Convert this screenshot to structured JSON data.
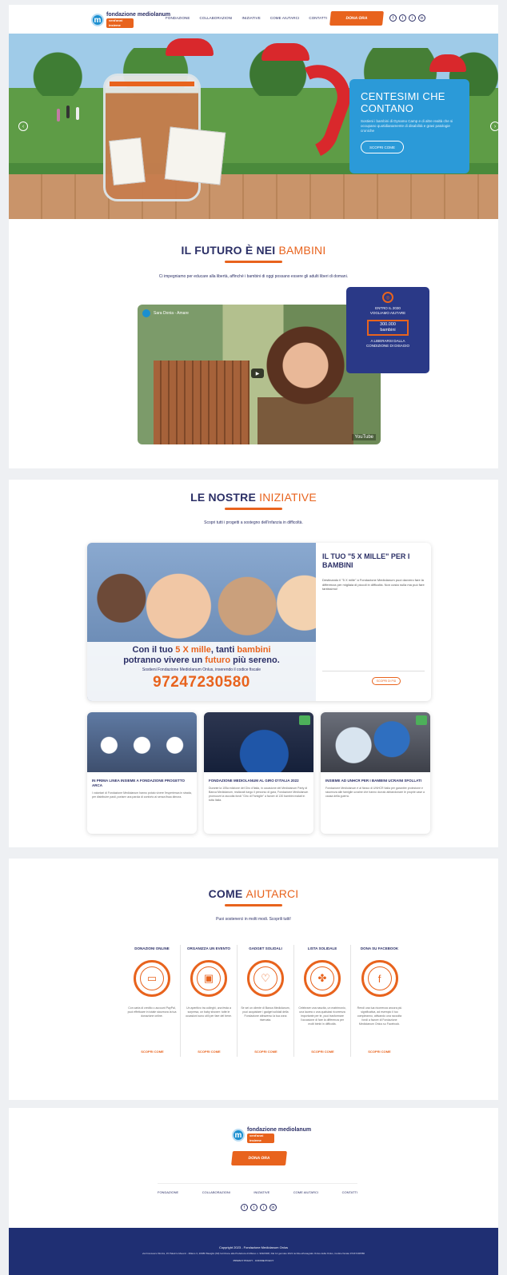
{
  "header": {
    "logo": {
      "name": "fondazione mediolanum",
      "sub": "onlus",
      "badge": "vent'anni insieme"
    },
    "nav": [
      "FONDAZIONE",
      "COLLABORAZIONI",
      "INIZIATIVE",
      "COME AIUTARCI",
      "CONTATTI"
    ],
    "donate": "DONA ORA",
    "social": [
      "f",
      "t",
      "i",
      "in"
    ]
  },
  "hero": {
    "title": "CENTESIMI CHE CONTANO",
    "text": "Sostieni i bambini di Dynamo Camp e di altre realtà che si occupano quotidianamente di disabilità e gravi patologie croniche",
    "button": "SCOPRI COME",
    "prev": "‹",
    "next": "›"
  },
  "futuro": {
    "title_a": "IL FUTURO È NEI",
    "title_b": "BAMBINI",
    "sub": "Ci impegniamo per educare alla libertà, affinché i bambini di oggi possano essere gli adulti liberi di domani.",
    "video": {
      "title": "Sara Donia - Amare",
      "yt": "YouTube",
      "play": "▶"
    },
    "stat": {
      "l1": "ENTRO IL 2030",
      "l2": "VOGLIAMO AIUTARE",
      "n": "300.000",
      "unit": "bambini",
      "l3": "A LIBERARSI DALLA",
      "l4": "CONDIZIONE DI DISAGIO"
    }
  },
  "iniziative": {
    "title_a": "LE NOSTRE",
    "title_b": "INIZIATIVE",
    "sub": "Scopri tutti i progetti a sostegno dell'infanzia in difficoltà.",
    "featured": {
      "overlay_1a": "Con il tuo",
      "overlay_1b": "5 X mille",
      "overlay_1c": ", tanti",
      "overlay_1d": "bambini",
      "overlay_2a": "potranno vivere un",
      "overlay_2b": "futuro",
      "overlay_2c": "più sereno.",
      "overlay_3": "Sostieni Fondazione Mediolanum Onlus, inserendo il codice fiscale",
      "cf": "97247230580",
      "title": "IL TUO \"5 X MILLE\" PER I BAMBINI",
      "text": "Destinando il \"5 X mille\" a Fondazione Mediolanum puoi davvero fare la differenza per migliaia di piccoli in difficoltà. Non costa nulla ma può fare tantissimo!",
      "button": "SCOPRI DI PIÙ"
    },
    "cards": [
      {
        "title": "IN PRIMA LINEA INSIEME A FONDAZIONE PROGETTO ARCA",
        "text": "I volontari di Fondazione Mediolanum hanno potuto vivere l'esperienza in strada, per distribuire pasti, portare una parola di conforto ai senza fissa dimora."
      },
      {
        "title": "FONDAZIONE MEDIOLANUM AL GIRO D'ITALIA 2022",
        "text": "Durante la 105a edizione del Giro d'Italia, in occasione del Mediolanum Party di Banca Mediolanum, realizzati lungo il percorso di gara, Fondazione Mediolanum promuove la raccolta fondi \"Giro di Famiglie\" a favore di 130 bambini malati in tutta Italia."
      },
      {
        "title": "INSIEME AD UNHCR PER I BAMBINI UCRAINI SFOLLATI",
        "text": "Fondazione Mediolanum è al fianco di UNHCR Italia per garantire protezione e sicurezza alle famiglie ucraine che hanno dovuto abbandonare le proprie case a causa della guerra."
      }
    ]
  },
  "aiutarci": {
    "title_a": "COME",
    "title_b": "AIUTARCI",
    "sub": "Puoi sostenerci in molti modi. Scoprili tutti!",
    "items": [
      {
        "title": "DONAZIONI ONLINE",
        "icon": "▭",
        "text": "Con carta di credito o account PayPal, puoi effettuare in totale sicurezza la tua donazione online.",
        "link": "SCOPRI COME"
      },
      {
        "title": "ORGANIZZA UN EVENTO",
        "icon": "▣",
        "text": "Un aperitivo tra colleghi, una festa a sorpresa, un baby shower: tutte le occasioni sono utili per fare del bene.",
        "link": "SCOPRI COME"
      },
      {
        "title": "GADGET SOLIDALI",
        "icon": "♡",
        "text": "Se sei un cliente di Banca Mediolanum, puoi acquistare i gadget solidali della Fondazione attraverso la tua zona riservata.",
        "link": "SCOPRI COME"
      },
      {
        "title": "LISTA SOLIDALE",
        "icon": "✤",
        "text": "Celebrare una nascita, un matrimonio, una laurea o una qualsiasi ricorrenza importante per te, puoi trasformare l'occasione di fare la differenza per molti bimbi in difficoltà.",
        "link": "SCOPRI COME"
      },
      {
        "title": "DONA SU FACEBOOK",
        "icon": "f",
        "text": "Rendi una tua ricorrenza ancora più significativa, ad esempio il tuo compleanno, attivando una raccolta fondi a favore di Fondazione Mediolanum Onlus su Facebook.",
        "link": "SCOPRI COME"
      }
    ]
  },
  "footer": {
    "donate": "DONA ORA",
    "nav": [
      "FONDAZIONE",
      "COLLABORAZIONI",
      "INIZIATIVE",
      "COME AIUTARCI",
      "CONTATTI"
    ],
    "social": [
      "f",
      "t",
      "i",
      "in"
    ],
    "copyright": "Copyright 2023 - Fondazione Mediolanum Onlus",
    "address": "via Francesco Sforza, 15 Palazzo Meucci - Milano 3, 20080 Basiglio (MI) Iscrizione alla Prefettura di Milano n. 909/2008, Dal 12 gennaio 2021 iscritta all'anagrafe Onlus della Onlus, Codice fiscale 97247230580",
    "links": "PRIVACY POLICY · COOKIE POLICY"
  },
  "colors": {
    "accent": "#e8631d",
    "navy": "#2b2f66",
    "blue": "#2b9ad8",
    "footer": "#1f2f73"
  }
}
